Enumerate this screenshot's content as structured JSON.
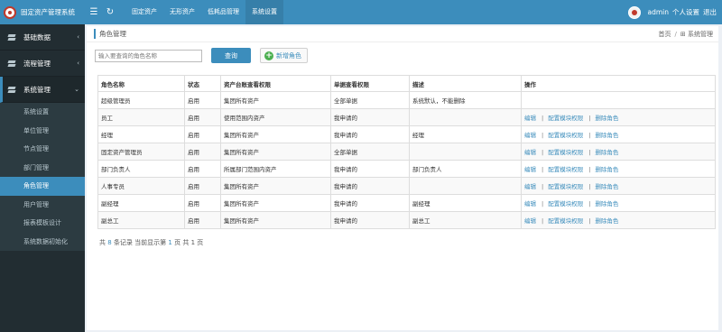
{
  "header": {
    "app_title": "固定资产管理系统",
    "nav": [
      "固定资产",
      "无形资产",
      "低耗品管理",
      "系统设置"
    ],
    "active_nav": 3,
    "user": "admin",
    "personal_settings": "个人设置",
    "logout": "退出"
  },
  "sidebar": {
    "menus": [
      "基础数据",
      "流程管理",
      "系统管理"
    ],
    "sub_items": [
      "系统设置",
      "单位管理",
      "节点管理",
      "部门管理",
      "角色管理",
      "用户管理",
      "报表模板设计",
      "系统数据初始化"
    ],
    "active_sub": 4
  },
  "page": {
    "title": "角色管理",
    "breadcrumb": [
      "首页",
      "系统管理"
    ]
  },
  "search": {
    "placeholder": "输入要查询的角色名称",
    "query_label": "查询",
    "add_label": "新增角色"
  },
  "table": {
    "headers": [
      "角色名称",
      "状态",
      "资产台账查看权限",
      "单据查看权限",
      "描述",
      "操作"
    ],
    "rows": [
      {
        "name": "超级管理员",
        "status": "启用",
        "asset_perm": "集团所有资产",
        "doc_perm": "全部单据",
        "desc": "系统默认，不能删除",
        "actions": []
      },
      {
        "name": "员工",
        "status": "启用",
        "asset_perm": "使用范围内资产",
        "doc_perm": "我申请的",
        "desc": "",
        "actions": [
          "编辑",
          "配置模块权限",
          "删除角色"
        ]
      },
      {
        "name": "经理",
        "status": "启用",
        "asset_perm": "集团所有资产",
        "doc_perm": "我申请的",
        "desc": "经理",
        "actions": [
          "编辑",
          "配置模块权限",
          "删除角色"
        ]
      },
      {
        "name": "固定资产管理员",
        "status": "启用",
        "asset_perm": "集团所有资产",
        "doc_perm": "全部单据",
        "desc": "",
        "actions": [
          "编辑",
          "配置模块权限",
          "删除角色"
        ]
      },
      {
        "name": "部门负责人",
        "status": "启用",
        "asset_perm": "所属部门范围内资产",
        "doc_perm": "我申请的",
        "desc": "部门负责人",
        "actions": [
          "编辑",
          "配置模块权限",
          "删除角色"
        ]
      },
      {
        "name": "人事专员",
        "status": "启用",
        "asset_perm": "集团所有资产",
        "doc_perm": "我申请的",
        "desc": "",
        "actions": [
          "编辑",
          "配置模块权限",
          "删除角色"
        ]
      },
      {
        "name": "副经理",
        "status": "启用",
        "asset_perm": "集团所有资产",
        "doc_perm": "我申请的",
        "desc": "副经理",
        "actions": [
          "编辑",
          "配置模块权限",
          "删除角色"
        ]
      },
      {
        "name": "副总工",
        "status": "启用",
        "asset_perm": "集团所有资产",
        "doc_perm": "我申请的",
        "desc": "副总工",
        "actions": [
          "编辑",
          "配置模块权限",
          "删除角色"
        ]
      }
    ]
  },
  "pagination": {
    "prefix": "共",
    "total": "8",
    "mid1": "条记录 当前显示第",
    "current": "1",
    "mid2": "页 共",
    "pages": "1",
    "suffix": "页"
  },
  "colors": {
    "primary": "#3c8dbc",
    "sidebar_bg": "#222d32",
    "add_icon": "#4caf50"
  }
}
